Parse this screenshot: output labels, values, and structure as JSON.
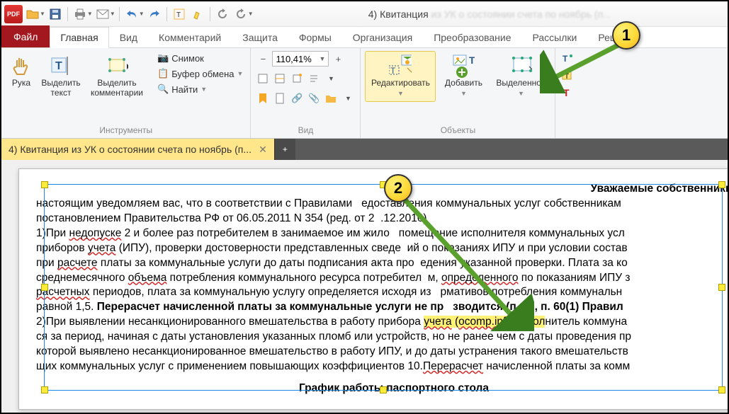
{
  "app": {
    "title": "4) Квитанция",
    "title_blur": "из УК о состоянии счета по ноябрь (п..."
  },
  "tabs": {
    "file": "Файл",
    "items": [
      "Главная",
      "Вид",
      "Комментарий",
      "Защита",
      "Формы",
      "Организация",
      "Преобразование",
      "Рассылки",
      "Реце"
    ],
    "active": 0
  },
  "ribbon": {
    "tools": {
      "hand": "Рука",
      "select_text": "Выделить\nтекст",
      "select_comments": "Выделить\nкомментарии",
      "snapshot": "Снимок",
      "clipboard": "Буфер обмена",
      "find": "Найти",
      "group": "Инструменты"
    },
    "view": {
      "zoom": "110,41%",
      "group": "Вид"
    },
    "objects": {
      "edit": "Редактировать",
      "add": "Добавить",
      "selected": "Выделенное",
      "group": "Объекты"
    }
  },
  "doctab": {
    "title": "4) Квитанция из УК о состоянии счета по ноябрь (п..."
  },
  "document": {
    "heading": "Уважаемые собственники (на",
    "p1a": "настоящим уведомляем вас, что в соответствии с Правилами ",
    "p1b": "едоставления коммунальных услуг собственникам",
    "p2a": "постановлением Правительства РФ от 06.05.2011 N 354 (ред. от 2",
    "p2b": ".12.2016)",
    "p3a": "1)При ",
    "p3_w1": "недопуске",
    "p3b": " 2 и более раз потребителем в занимаемое им жило",
    "p3c": " помещение исполнителя коммунальных усл",
    "p4a": "приборов ",
    "p4_w1": "учета",
    "p4b": " (ИПУ), проверки достоверности представленных сведе",
    "p4c": "ий о показаниях ИПУ и при условии состав",
    "p5a": "при ",
    "p5_w1": "расчете",
    "p5b": " платы за коммунальные услуги до даты подписания акта про",
    "p5c": "едения указанной проверки. Плата за ко",
    "p6a": "среднемесячного ",
    "p6_w1": "объема",
    "p6b": " потребления коммунального ресурса потребител",
    "p6c": "м, ",
    "p6_w2": "определенного",
    "p6d": " по показаниям ИПУ з",
    "p7a": "",
    "p7_w1": "расчетных",
    "p7b": " периодов, плата за коммунальную услугу определяется исходя из ",
    "p7c": "рмативов потребления коммунальн",
    "p8a": "равной 1,5. ",
    "p8_b": "Перерасчет начисленной платы за коммунальные услуги не пр",
    "p8_b2": "зводится (п. 59, п. 60(1) Правил",
    "p9a": "2)При выявлении несанкционированного вмешательства в работу прибора ",
    "p9_h1": "учета",
    "p9_h2": " (",
    "p9_h3": "ocomp.info",
    "p9_h4": " испол",
    "p9b": "нитель коммуна",
    "p10": "ся за период, начиная с даты установления указанных пломб или устройств, но не ранее чем с даты проведения пр",
    "p11": "которой выявлено несанкционированное вмешательство в работу ИПУ, и до даты устранения такого вмешательств",
    "p12a": "щих коммунальных услуг с применением повышающих коэффициентов 10.",
    "p12_w1": "Перерасчет",
    "p12b": " начисленной платы за комм",
    "heading2": "График работы паспортного стола"
  },
  "callouts": {
    "n1": "1",
    "n2": "2"
  }
}
